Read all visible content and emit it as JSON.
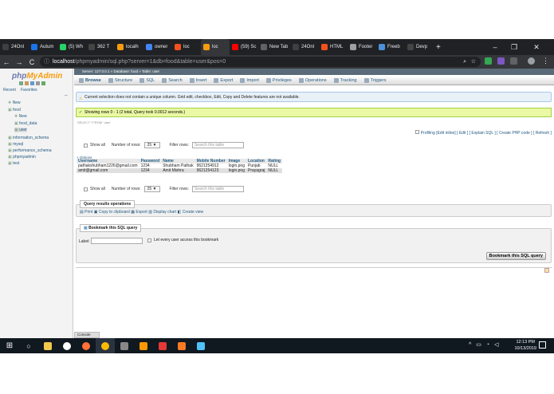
{
  "tabs": [
    {
      "label": "24Onl",
      "color": "#3c4043"
    },
    {
      "label": "Autum",
      "color": "#1a73e8"
    },
    {
      "label": "(5) Wh",
      "color": "#25d366"
    },
    {
      "label": "362 T",
      "color": "#444"
    },
    {
      "label": "localh",
      "color": "#f89c0e"
    },
    {
      "label": "owner",
      "color": "#4285f4"
    },
    {
      "label": "loc",
      "color": "#f4511e"
    },
    {
      "label": "loc",
      "color": "#f89c0e"
    },
    {
      "label": "(59) Sc",
      "color": "#ff0000"
    },
    {
      "label": "New Tab",
      "color": "#5f6368"
    },
    {
      "label": "24Onl",
      "color": "#3c4043"
    },
    {
      "label": "HTML",
      "color": "#f4511e"
    },
    {
      "label": "Footer",
      "color": "#9aa0a6"
    },
    {
      "label": "Freeb",
      "color": "#4a90d9"
    },
    {
      "label": "Devp",
      "color": "#444"
    }
  ],
  "browser": {
    "new_tab": "+",
    "minimize": "–",
    "maximize": "❐",
    "close": "✕",
    "back": "←",
    "forward": "→",
    "reload": "C",
    "url_host": "localhost",
    "url_path": "/phpmyadmin/sql.php?server=1&db=food&table=user&pos=0",
    "info": "ⓘ",
    "zoom": "⌕",
    "star": "☆",
    "menu": "⋮"
  },
  "sidebar": {
    "logo_php": "php",
    "logo_ma": "MyAdmin",
    "recent": "Recent",
    "favorites": "Favorites",
    "tree": [
      "New",
      "food",
      "New",
      "food_data",
      "user",
      "information_schema",
      "mysql",
      "performance_schema",
      "phpmyadmin",
      "test"
    ]
  },
  "crumb": "Server: 127.0.0.1 » Database: food » Table: user",
  "menu": [
    "Browse",
    "Structure",
    "SQL",
    "Search",
    "Insert",
    "Export",
    "Import",
    "Privileges",
    "Operations",
    "Tracking",
    "Triggers"
  ],
  "notice": "Current selection does not contain a unique column. Grid edit, checkbox, Edit, Copy and Delete features are not available.",
  "success": "Showing rows 0 - 1 (2 total, Query took 0.0012 seconds.)",
  "sql_query": "SELECT * FROM `user`",
  "profiling": "Profiling [Edit inline] [ Edit ] [ Explain SQL ] [ Create PHP code ] [ Refresh ]",
  "nav": {
    "show_all": "Show all",
    "num_rows": "Number of rows:",
    "rows_value": "25",
    "filter": "Filter rows:",
    "filter_placeholder": "Search this table"
  },
  "options": "+ Options",
  "columns": [
    "Username",
    "Password",
    "Name",
    "Mobile Number",
    "Image",
    "Location",
    "Rating"
  ],
  "rows": [
    [
      "pathakshubham1226@gmail.com",
      "1234",
      "Shubham Pathak",
      "9621254912",
      "login.png",
      "Punjab",
      "NULL"
    ],
    [
      "amit@gmail.com",
      "1234",
      "Amit Mishra",
      "9621254123",
      "login.png",
      "Prayagraj",
      "NULL"
    ]
  ],
  "qops": {
    "legend": "Query results operations",
    "print": "Print",
    "copy": "Copy to clipboard",
    "export": "Export",
    "chart": "Display chart",
    "view": "Create view"
  },
  "bookmark": {
    "legend": "Bookmark this SQL query",
    "label": "Label:",
    "checkbox": "Let every user access this bookmark",
    "button": "Bookmark this SQL query"
  },
  "console": "Console",
  "clock": {
    "time": "12:13 PM",
    "date": "10/13/2019"
  }
}
